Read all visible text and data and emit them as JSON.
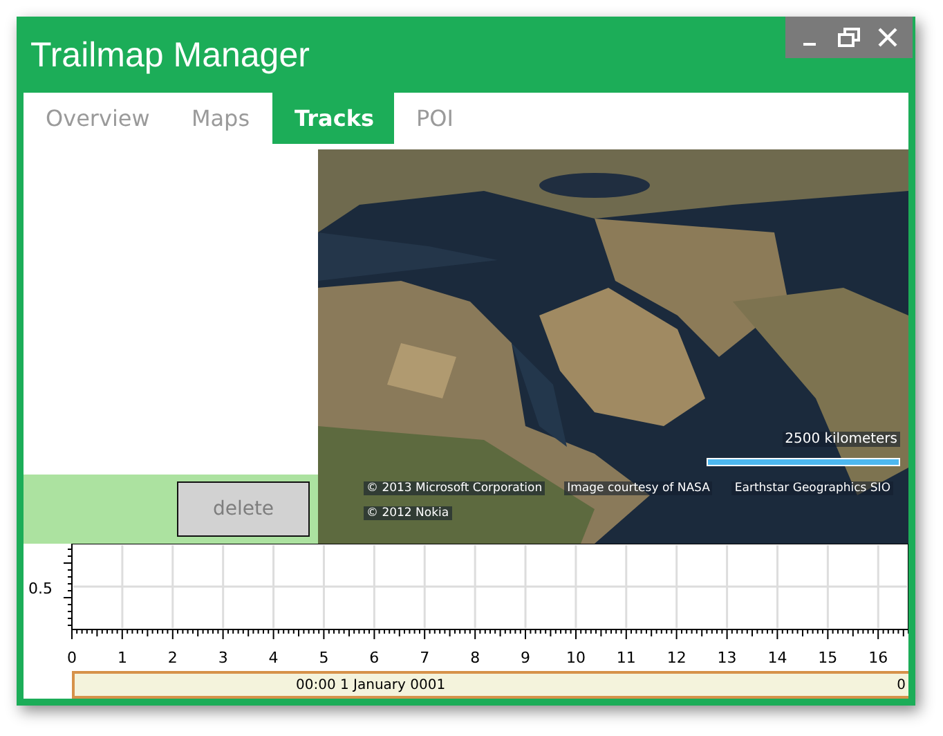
{
  "window": {
    "title": "Trailmap Manager"
  },
  "tabs": [
    {
      "label": "Overview",
      "selected": false
    },
    {
      "label": "Maps",
      "selected": false
    },
    {
      "label": "Tracks",
      "selected": true
    },
    {
      "label": "POI",
      "selected": false
    }
  ],
  "delete_button": {
    "label": "delete",
    "disabled": true
  },
  "map": {
    "kind": "picture",
    "scale_label": "2500 kilometers",
    "attributions": [
      "© 2013 Microsoft Corporation",
      "Image courtesy of NASA",
      "Earthstar Geographics  SIO"
    ],
    "attribution_line_2": "© 2012 Nokia"
  },
  "plot": {
    "x_axis_labels": [
      "0",
      "1",
      "2",
      "3",
      "4",
      "5",
      "6",
      "7",
      "8",
      "9",
      "10",
      "11",
      "12",
      "13",
      "14",
      "15",
      "16"
    ],
    "y_axis_labels": [
      "0.5"
    ]
  },
  "status_bar": {
    "time": "00:00 1 January 0001",
    "value": "0"
  }
}
